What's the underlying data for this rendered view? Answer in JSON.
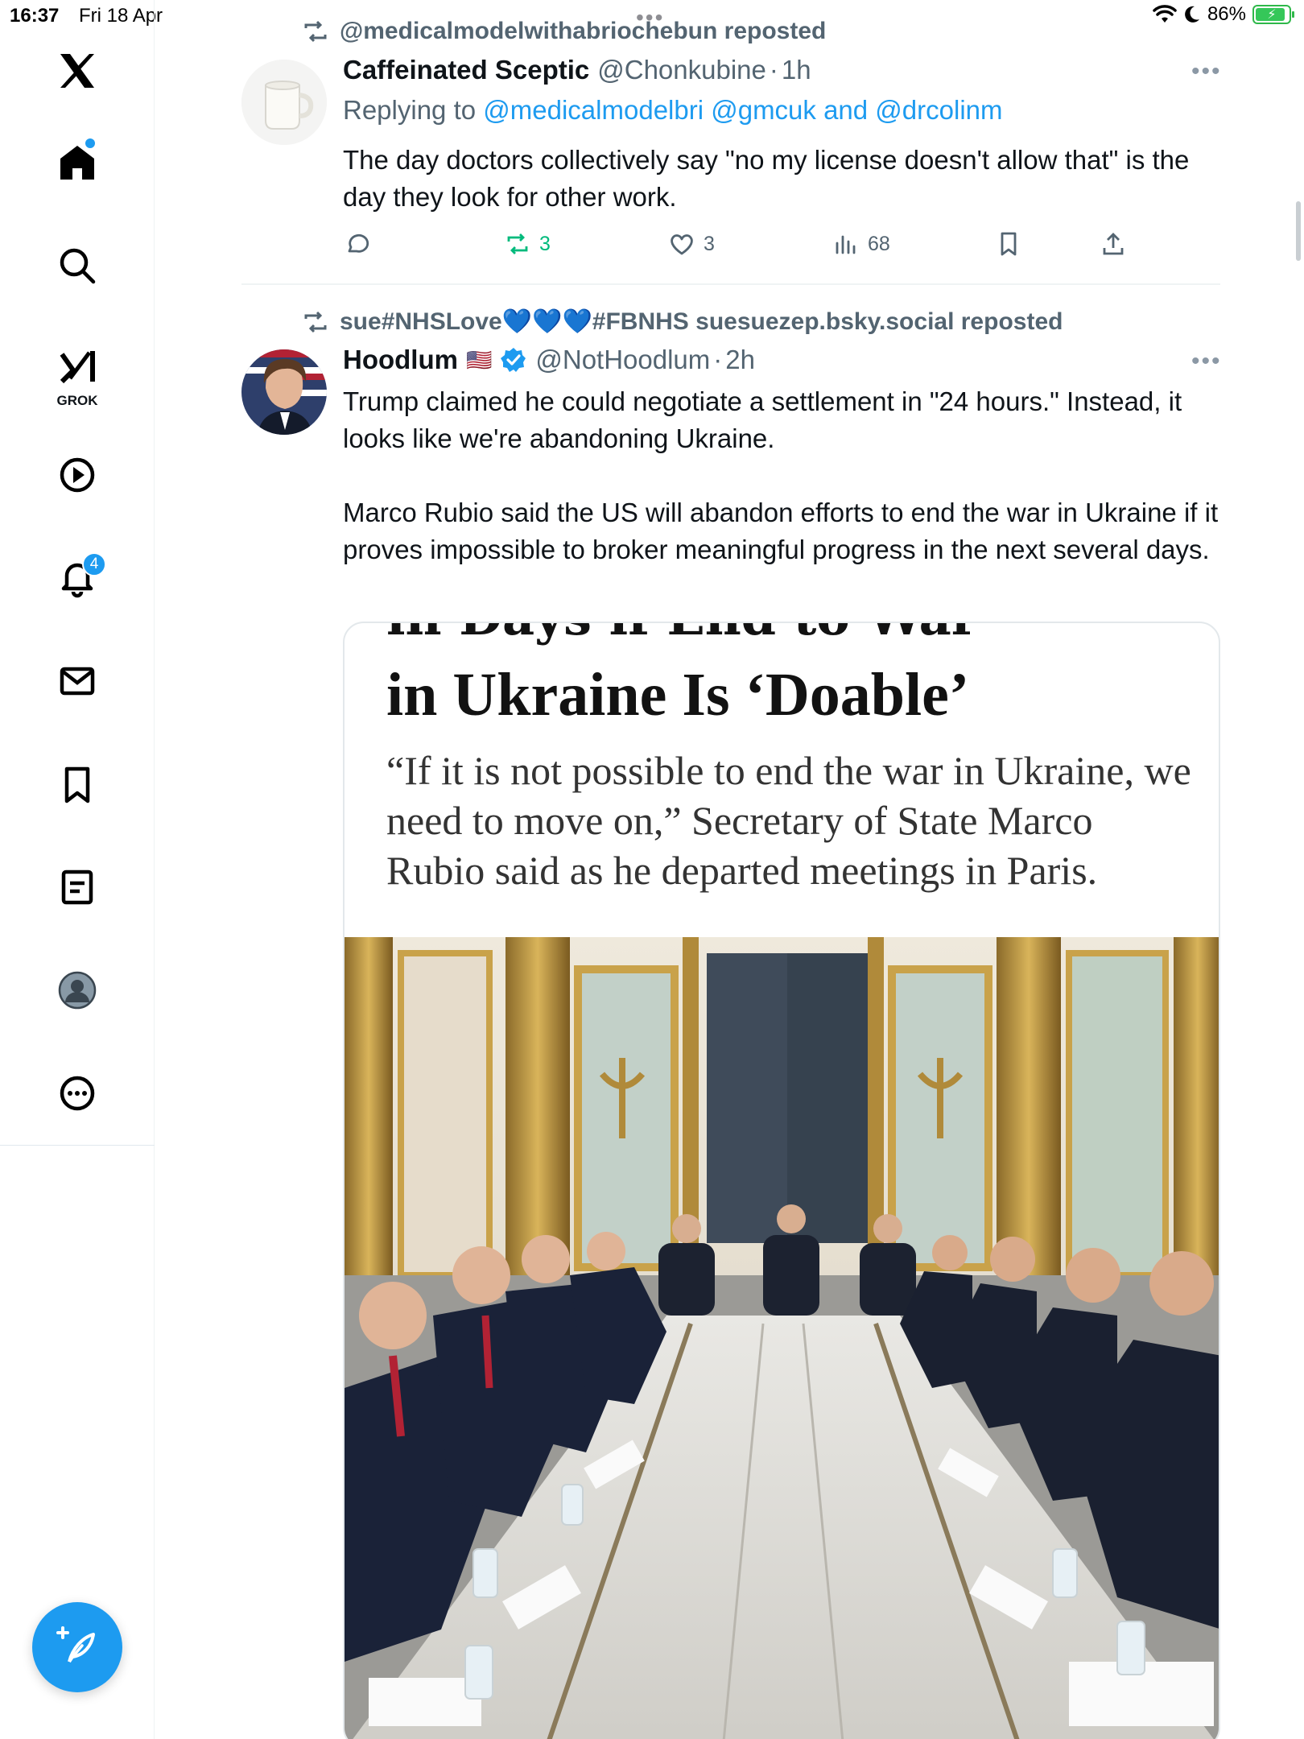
{
  "status_bar": {
    "time": "16:37",
    "date": "Fri 18 Apr",
    "battery": "86%"
  },
  "sidebar": {
    "items": [
      {
        "name": "x-logo-icon"
      },
      {
        "name": "home-icon",
        "has_dot": true
      },
      {
        "name": "search-icon"
      },
      {
        "name": "grok-icon",
        "label": "GROK"
      },
      {
        "name": "video-icon"
      },
      {
        "name": "notifications-icon",
        "badge": "4"
      },
      {
        "name": "messages-icon"
      },
      {
        "name": "bookmarks-icon"
      },
      {
        "name": "lists-icon"
      },
      {
        "name": "profile-icon"
      },
      {
        "name": "more-icon"
      }
    ],
    "compose_icon": "compose-icon"
  },
  "tweets": [
    {
      "repost_by": "@medicalmodelwithabriochebun reposted",
      "author_name": "Caffeinated Sceptic",
      "handle": "@Chonkubine",
      "dot": "·",
      "time": "1h",
      "reply_prefix": "Replying to",
      "reply_to": "@medicalmodelbri @gmcuk and @drcolinm",
      "text": "The day doctors collectively say \"no my license doesn't allow that\" is the day they look for other work.",
      "stats": {
        "reposts": "3",
        "likes": "3",
        "views": "68"
      }
    },
    {
      "repost_by": "sue#NHSLove💙💙💙#FBNHS suesuezep.bsky.social reposted",
      "author_name": "Hoodlum",
      "flag": "🇺🇸",
      "handle": "@NotHoodlum",
      "dot": "·",
      "time": "2h",
      "text_p1": "Trump claimed he could negotiate a settlement in \"24 hours.\" Instead, it looks like we're abandoning Ukraine.",
      "text_p2": "Marco Rubio said the US will abandon efforts to end the war in Ukraine if it proves impossible to broker meaningful progress in the next several days.",
      "card": {
        "headline_clipped": "in Days if End to War",
        "headline": "in Ukraine Is ‘Doable’",
        "deck": "“If it is not possible to end the war in Ukraine, we need to move on,” Secretary of State Marco Rubio said as he departed meetings in Paris."
      }
    }
  ],
  "colors": {
    "accent": "#1d9bf0",
    "repost_green": "#00ba7c",
    "secondary_text": "#536471",
    "gold": "#c9a24a"
  }
}
